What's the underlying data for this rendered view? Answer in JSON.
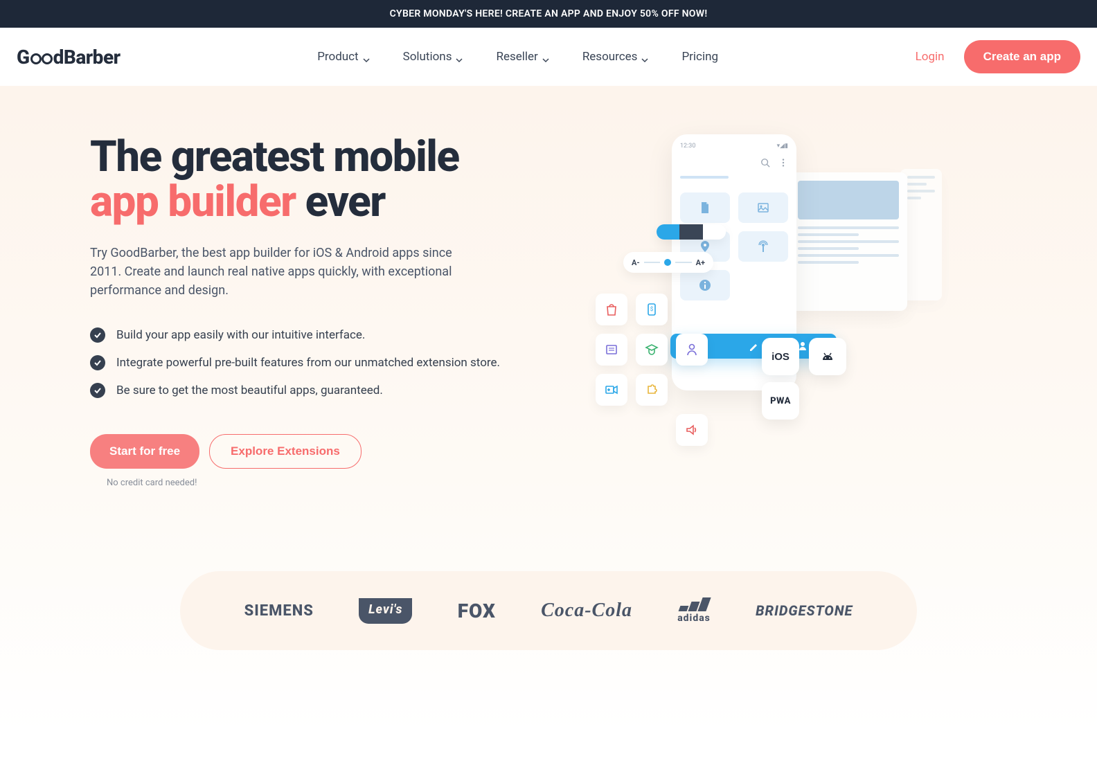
{
  "banner": "CYBER MONDAY'S HERE! CREATE AN APP AND ENJOY 50% OFF NOW!",
  "brand_name": "GoodBarber",
  "nav": {
    "items": [
      "Product",
      "Solutions",
      "Reseller",
      "Resources",
      "Pricing"
    ],
    "login": "Login",
    "cta": "Create an app"
  },
  "hero": {
    "title_1": "The greatest mobile",
    "title_accent": "app builder",
    "title_2": " ever",
    "description": "Try GoodBarber, the best app builder for iOS & Android apps since 2011. Create and launch real native apps quickly, with exceptional performance and design.",
    "bullets": [
      "Build your app easily with our intuitive interface.",
      "Integrate powerful pre-built features from our unmatched extension store.",
      "Be sure to get the most beautiful apps, guaranteed."
    ],
    "cta_primary": "Start for free",
    "cta_secondary": "Explore Extensions",
    "no_cc": "No credit card needed!",
    "phone_time": "12:30",
    "font_small": "A-",
    "font_large": "A+",
    "platforms": {
      "ios": "iOS",
      "pwa": "PWA"
    }
  },
  "brands": [
    "SIEMENS",
    "Levi's",
    "FOX",
    "Coca-Cola",
    "adidas",
    "BRIDGESTONE"
  ]
}
